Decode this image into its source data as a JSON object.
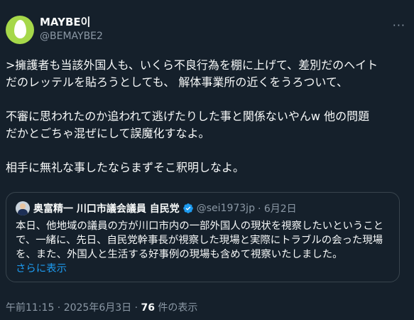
{
  "author": {
    "name": "MAYBE이",
    "handle": "@BEMAYBE2"
  },
  "more_glyph": "···",
  "tweet_lines": [
    ">擁護者も当該外国人も、いくら不良行為を棚に上げて、差別だのヘイト",
    "だのレッテルを貼ろうとしても、 解体事業所の近くをうろついて、",
    "",
    "不審に思われたのか追われて逃げたりした事と関係ないやんw 他の問題",
    "だかとごちゃ混ぜにして誤魔化すなよ。",
    "",
    "相手に無礼な事したならまずそこ釈明しなよ。"
  ],
  "quote": {
    "name": "奥富精一 川口市議会議員 自民党",
    "handle": "@sei1973jp",
    "date": "· 6月2日",
    "lines": [
      "本日、他地域の議員の方が川口市内の一部外国人の現状を視察したいということ",
      "で、一緒に、先日、自民党幹事長が視察した現場と実際にトラブルの会った現場",
      "を、また、外国人と生活する好事例の現場も含めて視察いたしました。"
    ],
    "show_more": "さらに表示",
    "verified_color": "#1d9bf0"
  },
  "footer": {
    "time": "午前11:15 · 2025年6月3日 · ",
    "views": "76",
    "views_label": " 件の表示"
  }
}
